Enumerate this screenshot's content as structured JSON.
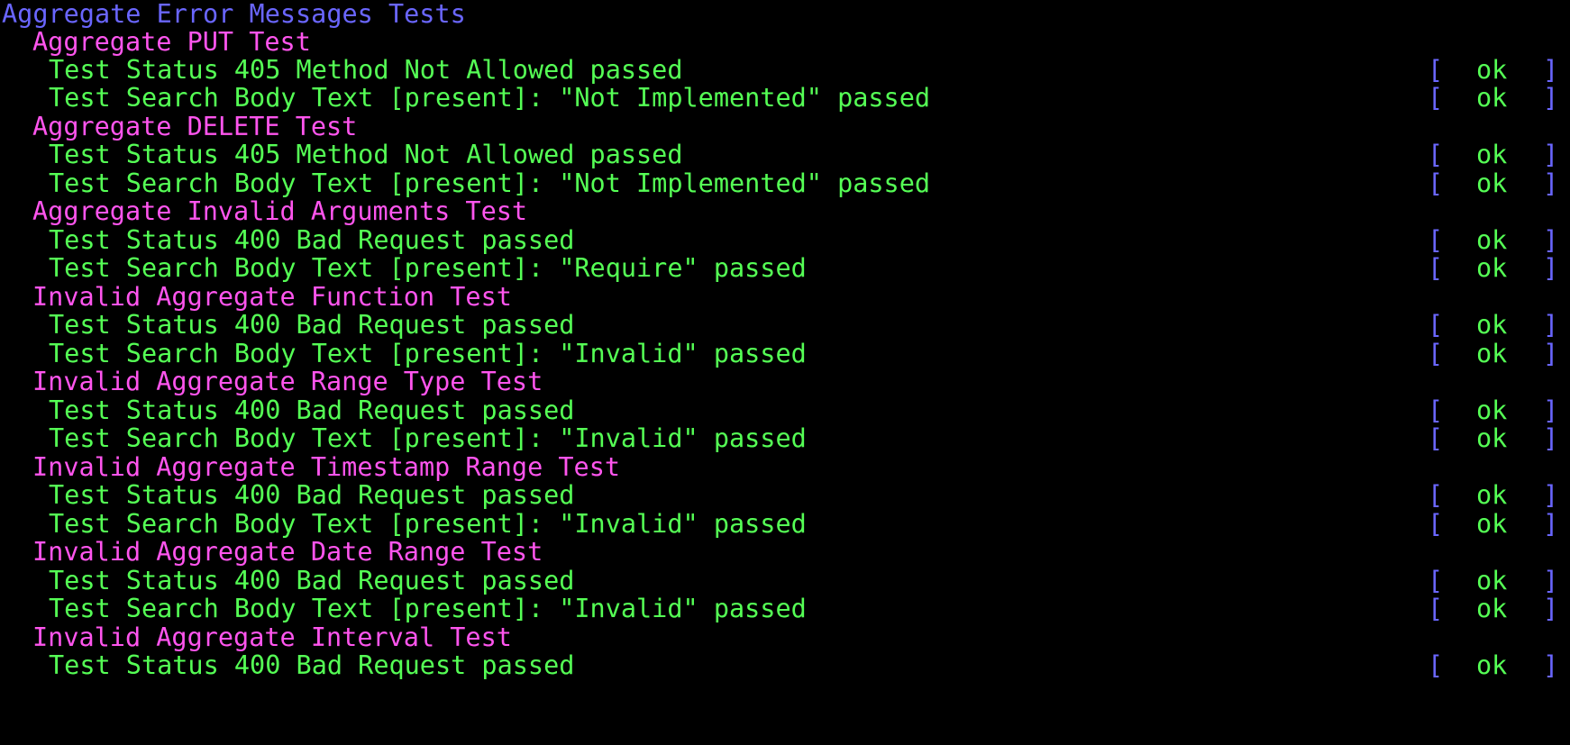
{
  "suite_title": "Aggregate Error Messages Tests",
  "status_bracket_open": "[",
  "status_bracket_close": "]",
  "groups": [
    {
      "title": "Aggregate PUT Test",
      "results": [
        {
          "text": "Test Status 405 Method Not Allowed passed",
          "status": "ok"
        },
        {
          "text": "Test Search Body Text [present]: \"Not Implemented\" passed",
          "status": "ok"
        }
      ]
    },
    {
      "title": "Aggregate DELETE Test",
      "results": [
        {
          "text": "Test Status 405 Method Not Allowed passed",
          "status": "ok"
        },
        {
          "text": "Test Search Body Text [present]: \"Not Implemented\" passed",
          "status": "ok"
        }
      ]
    },
    {
      "title": "Aggregate Invalid Arguments Test",
      "results": [
        {
          "text": "Test Status 400 Bad Request passed",
          "status": "ok"
        },
        {
          "text": "Test Search Body Text [present]: \"Require\" passed",
          "status": "ok"
        }
      ]
    },
    {
      "title": "Invalid Aggregate Function Test",
      "results": [
        {
          "text": "Test Status 400 Bad Request passed",
          "status": "ok"
        },
        {
          "text": "Test Search Body Text [present]: \"Invalid\" passed",
          "status": "ok"
        }
      ]
    },
    {
      "title": "Invalid Aggregate Range Type Test",
      "results": [
        {
          "text": "Test Status 400 Bad Request passed",
          "status": "ok"
        },
        {
          "text": "Test Search Body Text [present]: \"Invalid\" passed",
          "status": "ok"
        }
      ]
    },
    {
      "title": "Invalid Aggregate Timestamp Range Test",
      "results": [
        {
          "text": "Test Status 400 Bad Request passed",
          "status": "ok"
        },
        {
          "text": "Test Search Body Text [present]: \"Invalid\" passed",
          "status": "ok"
        }
      ]
    },
    {
      "title": "Invalid Aggregate Date Range Test",
      "results": [
        {
          "text": "Test Status 400 Bad Request passed",
          "status": "ok"
        },
        {
          "text": "Test Search Body Text [present]: \"Invalid\" passed",
          "status": "ok"
        }
      ]
    },
    {
      "title": "Invalid Aggregate Interval Test",
      "results": [
        {
          "text": "Test Status 400 Bad Request passed",
          "status": "ok"
        }
      ]
    }
  ],
  "colors": {
    "background": "#000000",
    "suite_title": "#6a66ff",
    "test_title": "#ff55ee",
    "passed_text": "#55ff55",
    "brackets": "#6a66ff",
    "ok": "#55ff55"
  }
}
